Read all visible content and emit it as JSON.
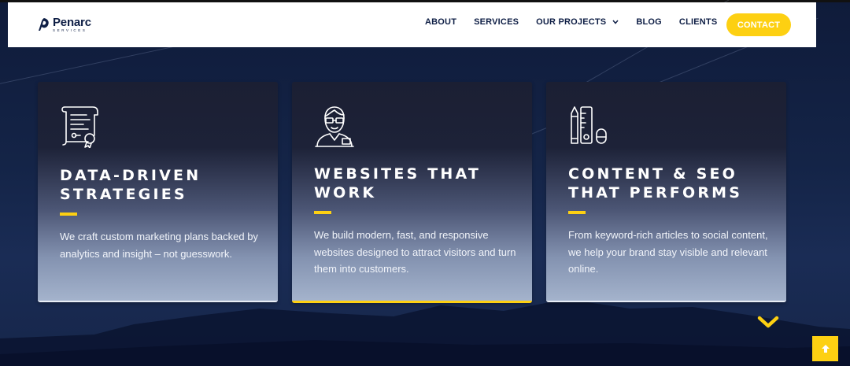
{
  "brand": {
    "name": "Penarc",
    "tagline": "SERVICES",
    "accent_color": "#fdd012",
    "navy_color": "#0e1e45"
  },
  "nav": {
    "items": [
      {
        "label": "ABOUT"
      },
      {
        "label": "SERVICES"
      },
      {
        "label": "OUR PROJECTS",
        "has_dropdown": true
      },
      {
        "label": "BLOG"
      },
      {
        "label": "CLIENTS"
      }
    ],
    "cta": "CONTACT"
  },
  "cards": [
    {
      "icon": "certificate-icon",
      "title": "DATA-DRIVEN STRATEGIES",
      "text": "We craft custom marketing plans backed by analytics and insight – not guesswork."
    },
    {
      "icon": "developer-icon",
      "title": "WEBSITES THAT WORK",
      "text": "We build modern, fast, and responsive websites designed to attract visitors and turn them into customers."
    },
    {
      "icon": "design-tools-icon",
      "title": "CONTENT & SEO THAT PERFORMS",
      "text": "From keyword-rich articles to social content, we help your brand stay visible and relevant online."
    }
  ],
  "icons": {
    "scroll_down": "chevron-down-icon",
    "back_to_top": "arrow-up-icon"
  }
}
